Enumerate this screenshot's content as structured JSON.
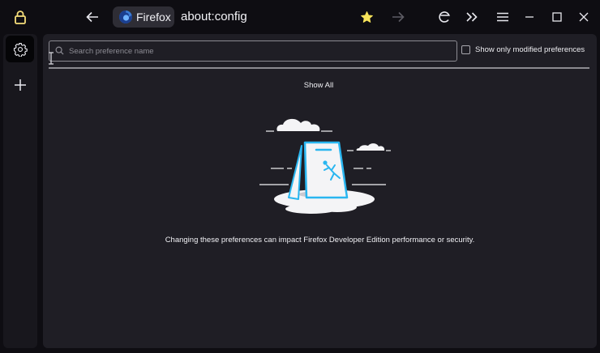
{
  "toolbar": {
    "identity_label": "Firefox",
    "url": "about:config"
  },
  "icons": {
    "lock": "lock-icon",
    "back": "arrow-left-icon",
    "firefox": "firefox-logo-icon",
    "star": "star-icon",
    "forward": "arrow-right-icon",
    "extension": "extension-icon",
    "overflow": "chevrons-right-icon",
    "menu": "hamburger-menu-icon",
    "minimize": "minimize-icon",
    "maximize": "maximize-icon",
    "close": "close-icon",
    "settings": "gear-icon",
    "add": "plus-icon"
  },
  "config": {
    "search_placeholder": "Search preference name",
    "modified_label": "Show only modified preferences",
    "modified_checked": false,
    "show_all": "Show All",
    "warning": "Changing these preferences can impact Firefox Developer Edition performance or security."
  },
  "colors": {
    "lock": "#f5dd7a",
    "star": "#f7e35a",
    "illustration_accent": "#29b6f0"
  }
}
